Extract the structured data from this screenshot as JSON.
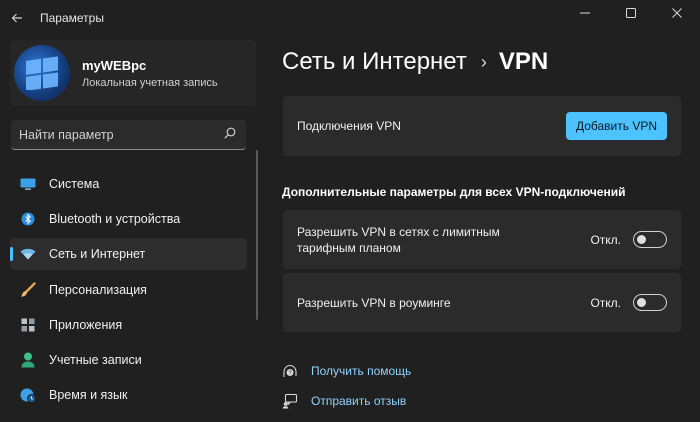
{
  "window": {
    "title": "Параметры",
    "minimize_glyph": "—",
    "maximize_glyph": "☐",
    "close_glyph": "✕"
  },
  "profile": {
    "name": "myWEBpc",
    "account_type": "Локальная учетная запись"
  },
  "search": {
    "placeholder": "Найти параметр"
  },
  "sidebar": {
    "items": [
      {
        "label": "Система",
        "icon": "monitor-icon",
        "active": false
      },
      {
        "label": "Bluetooth и устройства",
        "icon": "bluetooth-icon",
        "active": false
      },
      {
        "label": "Сеть и Интернет",
        "icon": "wifi-icon",
        "active": true
      },
      {
        "label": "Персонализация",
        "icon": "brush-icon",
        "active": false
      },
      {
        "label": "Приложения",
        "icon": "apps-icon",
        "active": false
      },
      {
        "label": "Учетные записи",
        "icon": "person-icon",
        "active": false
      },
      {
        "label": "Время и язык",
        "icon": "globe-clock-icon",
        "active": false
      }
    ]
  },
  "main": {
    "breadcrumb_parent": "Сеть и Интернет",
    "breadcrumb_separator": "›",
    "breadcrumb_current": "VPN",
    "vpn_card": {
      "label": "Подключения VPN",
      "button": "Добавить VPN"
    },
    "section_title": "Дополнительные параметры для всех VPN-подключений",
    "settings": [
      {
        "label_line1": "Разрешить VPN в сетях с лимитным",
        "label_line2": "тарифным планом",
        "state": "Откл."
      },
      {
        "label_line1": "Разрешить VPN в роуминге",
        "label_line2": "",
        "state": "Откл."
      }
    ],
    "links": [
      {
        "label": "Получить помощь",
        "icon": "help-icon"
      },
      {
        "label": "Отправить отзыв",
        "icon": "feedback-icon"
      }
    ]
  },
  "colors": {
    "background": "#202020",
    "card": "#2b2b2b",
    "accent": "#4cc2ff",
    "link": "#8fd3ff"
  }
}
